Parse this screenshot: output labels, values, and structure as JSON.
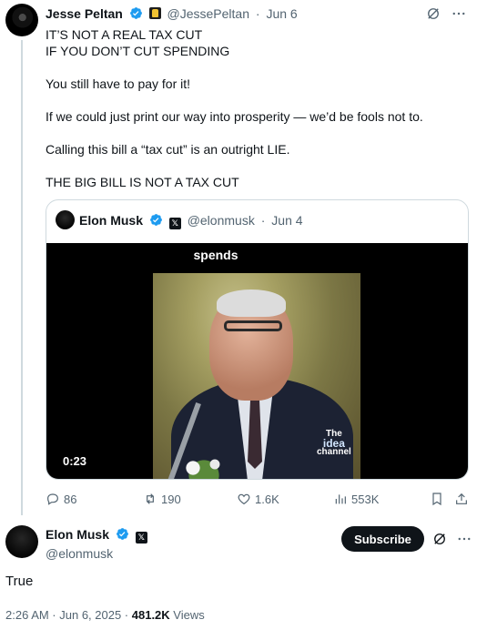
{
  "original_tweet": {
    "name": "Jesse Peltan",
    "handle": "@JessePeltan",
    "date": "Jun 6",
    "separator": "·",
    "lines": [
      "IT’S NOT A REAL TAX CUT",
      "IF YOU DON’T CUT SPENDING",
      "You still have to pay for it!",
      "If we could just print our way into prosperity — we’d be fools not to.",
      "Calling this bill a “tax cut” is an outright LIE.",
      "THE BIG BILL IS NOT A TAX CUT"
    ]
  },
  "quoted_tweet": {
    "name": "Elon Musk",
    "handle": "@elonmusk",
    "date": "Jun 4",
    "separator": "·",
    "video": {
      "caption": "spends",
      "duration": "0:23",
      "logo_small": "The",
      "logo_big": "idea",
      "logo_sub": "channel"
    }
  },
  "actions": {
    "replies": "86",
    "reposts": "190",
    "likes": "1.6K",
    "views": "553K"
  },
  "reply_tweet": {
    "name": "Elon Musk",
    "handle": "@elonmusk",
    "subscribe_label": "Subscribe",
    "text": "True",
    "time": "2:26 AM · Jun 6, 2025 · ",
    "views_count": "481.2K",
    "views_label": " Views"
  },
  "colors": {
    "verified": "#1d9bf0",
    "text": "#0f1419",
    "muted": "#536471",
    "border": "#cfd9de"
  },
  "icons": [
    "grok-icon",
    "more-icon",
    "reply-icon",
    "repost-icon",
    "like-icon",
    "views-icon",
    "bookmark-icon",
    "share-icon",
    "verified-icon",
    "x-affiliate-icon"
  ]
}
